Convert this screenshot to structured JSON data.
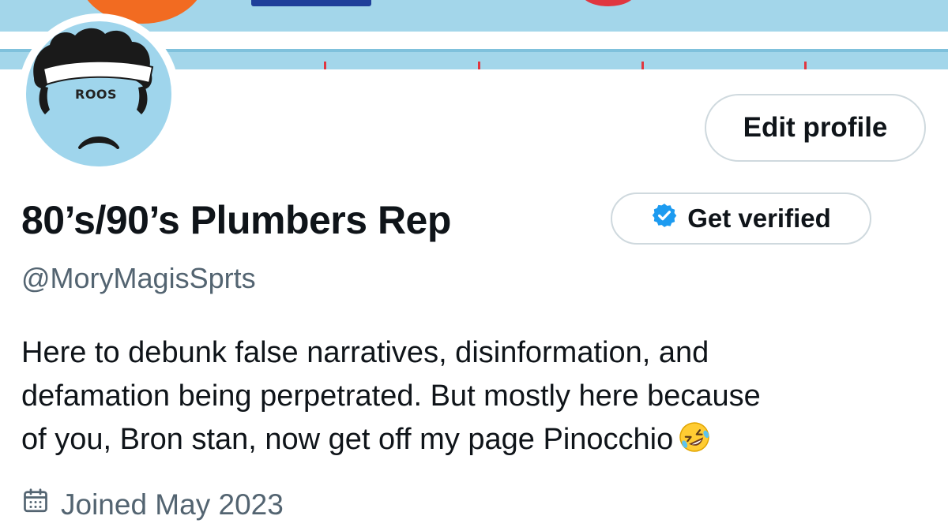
{
  "profile": {
    "avatar_badge_text": "ROOS",
    "display_name": "80’s/90’s Plumbers Rep",
    "handle": "@MoryMagisSprts",
    "bio_lines": [
      "Here to debunk false narratives, disinformation, and",
      "defamation being perpetrated. But mostly here because",
      "of you, Bron stan, now get off my page Pinocchio"
    ],
    "bio_emoji": "rolling-on-floor-laughing-emoji",
    "joined": "Joined May 2023"
  },
  "buttons": {
    "edit_profile": "Edit profile",
    "get_verified": "Get verified"
  },
  "icons": {
    "verified": "verified-badge-icon",
    "calendar": "calendar-icon"
  },
  "colors": {
    "primary_text": "#0f1419",
    "secondary_text": "#536471",
    "border": "#cfd9de",
    "verified_blue": "#1d9bf0",
    "banner": "#a3d6ea"
  }
}
